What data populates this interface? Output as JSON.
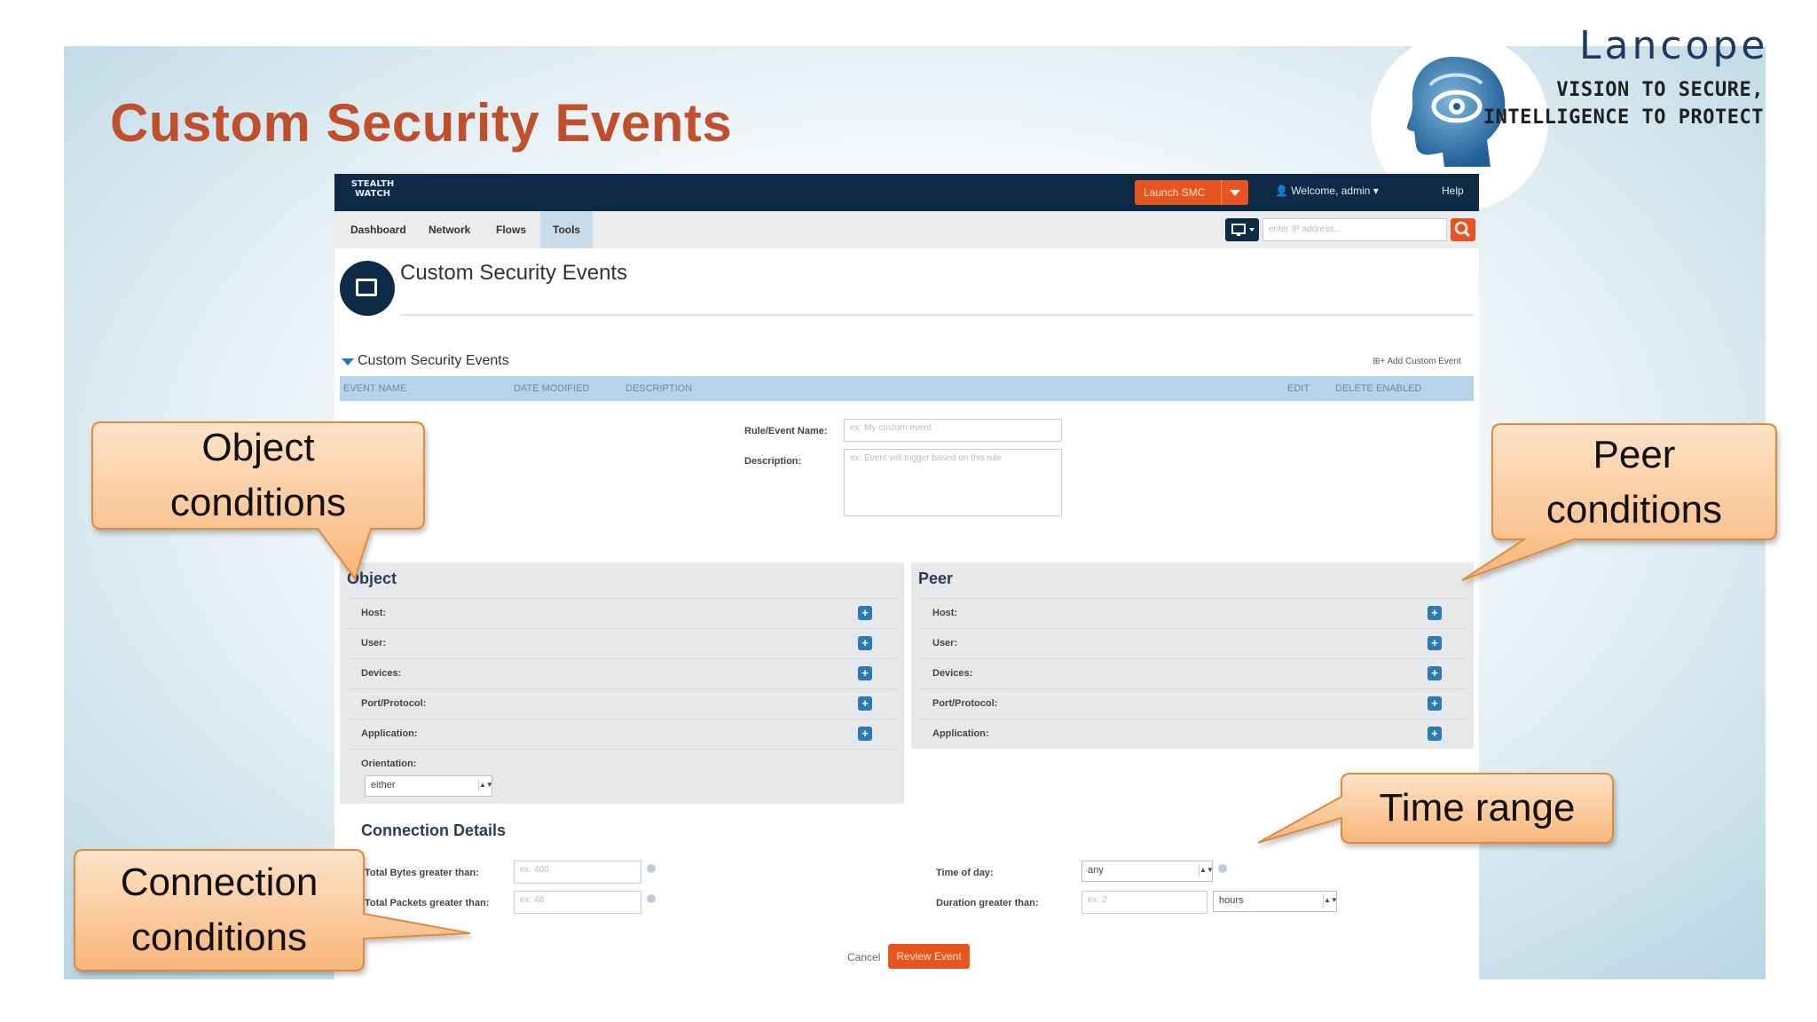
{
  "slide": {
    "title": "Custom Security Events",
    "brand": {
      "name": "Lancope",
      "tagline_line1": "VISION TO SECURE,",
      "tagline_line2": "INTELLIGENCE TO PROTECT"
    }
  },
  "app": {
    "logo_text_line1": "STEALTH",
    "logo_text_line2": "WATCH",
    "launch_button": "Launch SMC",
    "user_menu": "Welcome, admin",
    "help": "Help",
    "tabs": [
      "Dashboard",
      "Network",
      "Flows",
      "Tools"
    ],
    "active_tab": "Tools",
    "ip_search_placeholder": "enter IP address...",
    "page_title": "Custom Security Events",
    "section_title": "Custom Security Events",
    "add_link": "Add Custom Event",
    "table_headers": {
      "left": [
        "EVENT NAME",
        "DATE MODIFIED",
        "DESCRIPTION"
      ],
      "right": [
        "EDIT",
        "DELETE",
        "ENABLED"
      ]
    },
    "form": {
      "rule_name_label": "Rule/Event Name:",
      "rule_name_placeholder": "ex: My custom event",
      "description_label": "Description:",
      "description_placeholder": "ex: Event will trigger based on this rule"
    },
    "object_panel": {
      "title": "Object",
      "rows": [
        "Host:",
        "User:",
        "Devices:",
        "Port/Protocol:",
        "Application:"
      ],
      "orientation_label": "Orientation:",
      "orientation_value": "either"
    },
    "peer_panel": {
      "title": "Peer",
      "rows": [
        "Host:",
        "User:",
        "Devices:",
        "Port/Protocol:",
        "Application:"
      ]
    },
    "connection": {
      "title": "Connection Details",
      "total_bytes_label": "Total Bytes greater than:",
      "total_bytes_placeholder": "ex: 400",
      "total_packets_label": "Total Packets greater than:",
      "total_packets_placeholder": "ex: 48",
      "time_of_day_label": "Time of day:",
      "time_of_day_value": "any",
      "duration_label": "Duration greater than:",
      "duration_placeholder": "ex: 2",
      "duration_unit": "hours"
    },
    "cancel": "Cancel",
    "review_button": "Review Event"
  },
  "callouts": {
    "object": {
      "line1": "Object",
      "line2": "conditions"
    },
    "peer": {
      "line1": "Peer",
      "line2": "conditions"
    },
    "time": {
      "line1": "Time range"
    },
    "connection": {
      "line1": "Connection",
      "line2": "conditions"
    }
  },
  "colors": {
    "title": "#c0502c",
    "navbar": "#0d2b47",
    "accent_orange": "#e8541f",
    "callout_fill": "#fbc99b",
    "callout_border": "#e08a3c"
  }
}
